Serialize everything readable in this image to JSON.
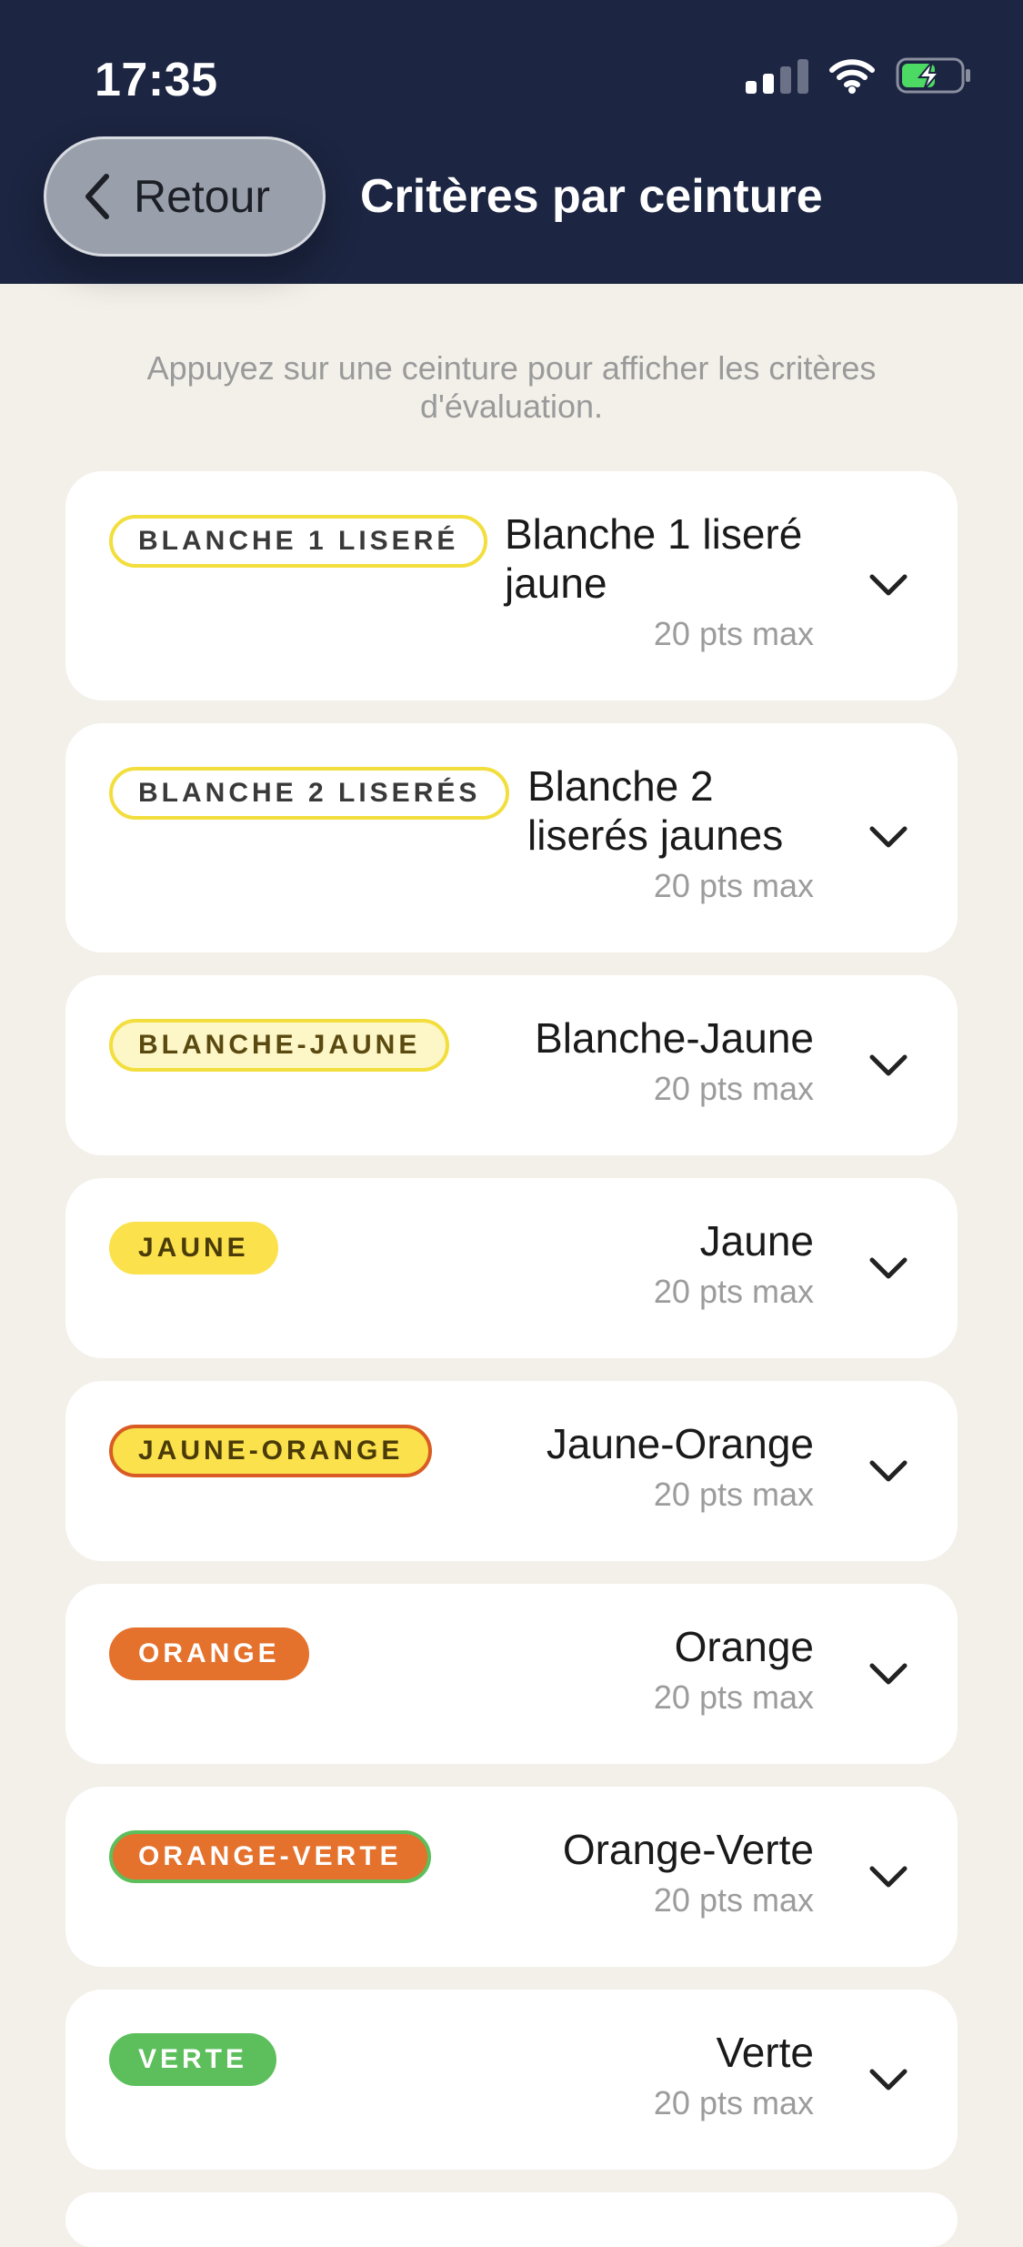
{
  "status_bar": {
    "time": "17:35",
    "icons": [
      "cellular-signal-icon",
      "wifi-icon",
      "battery-charging-icon"
    ]
  },
  "header": {
    "back_label": "Retour",
    "title": "Critères par ceinture",
    "background": "#1c2541"
  },
  "hint": "Appuyez sur une ceinture pour afficher les critères d'évaluation.",
  "belts": [
    {
      "badge": "BLANCHE 1 LISERÉ",
      "name": "Blanche 1 liseré jaune",
      "points": "20 pts max",
      "badge_bg": "#ffffff",
      "badge_border": "#f2de3d",
      "badge_text": "#3a3a3a"
    },
    {
      "badge": "BLANCHE 2 LISERÉS",
      "name": "Blanche 2 liserés jaunes",
      "points": "20 pts max",
      "badge_bg": "#ffffff",
      "badge_border": "#f2de3d",
      "badge_text": "#3a3a3a"
    },
    {
      "badge": "BLANCHE-JAUNE",
      "name": "Blanche-Jaune",
      "points": "20 pts max",
      "badge_bg": "#fdf6c7",
      "badge_border": "#f2de3d",
      "badge_text": "#5a4a10"
    },
    {
      "badge": "JAUNE",
      "name": "Jaune",
      "points": "20 pts max",
      "badge_bg": "#fbe14b",
      "badge_border": "#fbe14b",
      "badge_text": "#4a3b08"
    },
    {
      "badge": "JAUNE-ORANGE",
      "name": "Jaune-Orange",
      "points": "20 pts max",
      "badge_bg": "#fbe14b",
      "badge_border": "#d95c24",
      "badge_text": "#4a3b08"
    },
    {
      "badge": "ORANGE",
      "name": "Orange",
      "points": "20 pts max",
      "badge_bg": "#e4712c",
      "badge_border": "#e4712c",
      "badge_text": "#ffffff"
    },
    {
      "badge": "ORANGE-VERTE",
      "name": "Orange-Verte",
      "points": "20 pts max",
      "badge_bg": "#e4712c",
      "badge_border": "#5cbf5c",
      "badge_text": "#ffffff"
    },
    {
      "badge": "VERTE",
      "name": "Verte",
      "points": "20 pts max",
      "badge_bg": "#5cbf5c",
      "badge_border": "#5cbf5c",
      "badge_text": "#ffffff"
    }
  ]
}
